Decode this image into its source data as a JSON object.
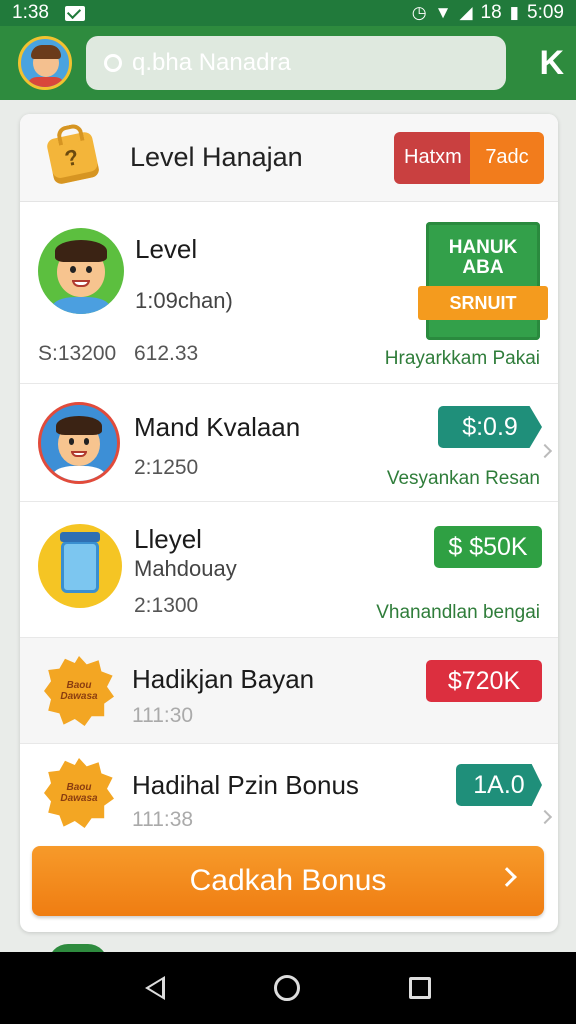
{
  "status_bar": {
    "time_left": "1:38",
    "battery_text": "18",
    "time_right": "5:09"
  },
  "header": {
    "search_placeholder": "q.bha Nanadra",
    "right_icon": "K"
  },
  "card": {
    "title": "Level Hanajan",
    "segment_left": "Hatxm",
    "segment_right": "7adc"
  },
  "rows": [
    {
      "title": "Level",
      "subtitle": "1:09chan)",
      "meta_left": "S:13200",
      "meta_right": "612.33",
      "promo_line1": "HANUK",
      "promo_line2": "ABA",
      "promo_ribbon": "SRNUIT",
      "link": "Hrayarkkam Pakai"
    },
    {
      "title": "Mand Kvalaan",
      "meta": "2:1250",
      "pill": "$:0.9",
      "pill_color": "#1f8f7a",
      "link": "Vesyankan Resan"
    },
    {
      "title": "Lleyel",
      "subtitle": "Mahdouay",
      "meta": "2:1300",
      "pill": "$ $50K",
      "pill_color": "#2fa043",
      "link": "Vhanandlan bengai"
    },
    {
      "title": "Hadikjan Bayan",
      "meta": "111:30",
      "pill": "$720K",
      "pill_color": "#dc2f3f",
      "badge_text": "Baou Dawasa"
    },
    {
      "title": "Hadihal Pzin Bonus",
      "meta": "111:38",
      "pill": "1A.0",
      "pill_color": "#1f8f7a",
      "badge_text": "Baou Dawasa"
    }
  ],
  "cta": {
    "label": "Cadkah Bonus"
  }
}
